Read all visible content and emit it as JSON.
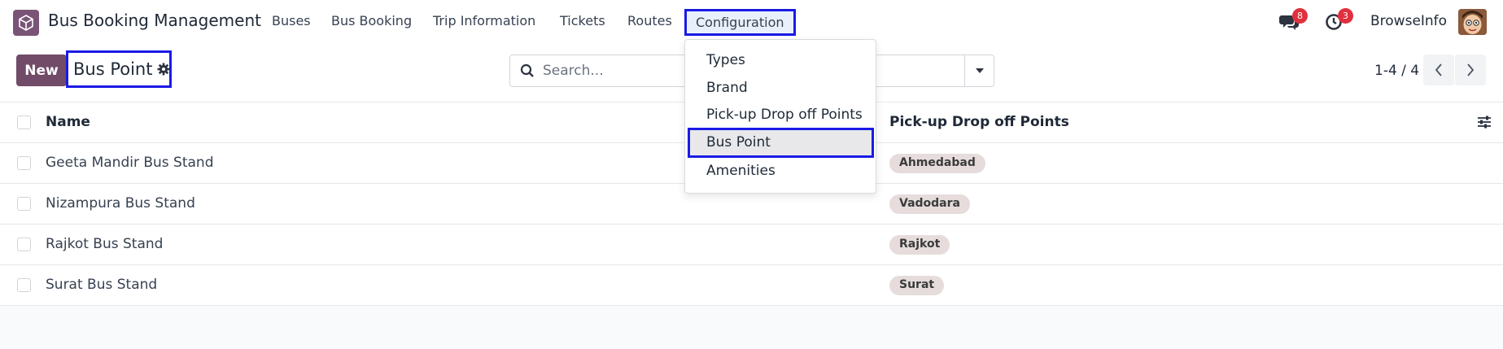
{
  "app": {
    "title": "Bus Booking Management",
    "icon": "app-cube-icon",
    "accent_color": "#714b67",
    "highlight_color": "#1a1ae6"
  },
  "menu": {
    "items": [
      {
        "label": "Buses"
      },
      {
        "label": "Bus Booking"
      },
      {
        "label": "Trip Information"
      },
      {
        "label": "Tickets"
      },
      {
        "label": "Routes"
      },
      {
        "label": "Configuration"
      }
    ]
  },
  "systray": {
    "messages_icon": "chat-icon",
    "messages_count": "8",
    "activities_icon": "clock-icon",
    "activities_count": "3",
    "user_name": "BrowseInfo"
  },
  "control_panel": {
    "new_label": "New",
    "breadcrumb": "Bus Point",
    "search_placeholder": "Search...",
    "pager": "1-4 / 4"
  },
  "list": {
    "columns": [
      "Name",
      "Pick-up Drop off Points"
    ],
    "rows": [
      {
        "name": "Geeta Mandir Bus Stand",
        "point": "Ahmedabad"
      },
      {
        "name": "Nizampura Bus Stand",
        "point": "Vadodara"
      },
      {
        "name": "Rajkot Bus Stand",
        "point": "Rajkot"
      },
      {
        "name": "Surat Bus Stand",
        "point": "Surat"
      }
    ]
  },
  "configuration_menu": {
    "items": [
      {
        "label": "Types"
      },
      {
        "label": "Brand"
      },
      {
        "label": "Pick-up Drop off Points"
      },
      {
        "label": "Bus Point",
        "selected": true
      },
      {
        "label": "Amenities"
      }
    ]
  }
}
